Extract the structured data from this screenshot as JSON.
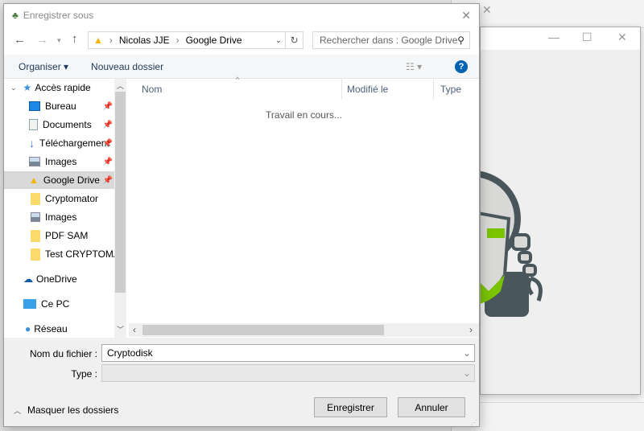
{
  "dialog": {
    "title": "Enregistrer sous",
    "close": "✕"
  },
  "address": {
    "segments": [
      "Nicolas JJE",
      "Google Drive"
    ],
    "separator": "›"
  },
  "search": {
    "placeholder": "Rechercher dans : Google Drive"
  },
  "toolbar": {
    "organize": "Organiser ▾",
    "new_folder": "Nouveau dossier",
    "help": "?"
  },
  "nav": {
    "items": [
      {
        "label": "Accès rapide",
        "icon": "star-icon",
        "pinned": false
      },
      {
        "label": "Bureau",
        "icon": "desktop-icon",
        "pinned": true
      },
      {
        "label": "Documents",
        "icon": "documents-icon",
        "pinned": true
      },
      {
        "label": "Téléchargements",
        "icon": "download-icon",
        "pinned": true
      },
      {
        "label": "Images",
        "icon": "images-icon",
        "pinned": true
      },
      {
        "label": "Google Drive",
        "icon": "google-drive-icon",
        "pinned": true,
        "selected": true
      },
      {
        "label": "Cryptomator",
        "icon": "folder-icon"
      },
      {
        "label": "Images",
        "icon": "images-icon"
      },
      {
        "label": "PDF SAM",
        "icon": "folder-icon"
      },
      {
        "label": "Test CRYPTOMATOR",
        "icon": "folder-icon"
      },
      {
        "label": "OneDrive",
        "icon": "onedrive-icon"
      },
      {
        "label": "Ce PC",
        "icon": "pc-icon"
      },
      {
        "label": "Réseau",
        "icon": "network-icon"
      }
    ]
  },
  "columns": [
    "Nom",
    "Modifié le",
    "Type"
  ],
  "status": "Travail en cours...",
  "form": {
    "filename_label": "Nom du fichier :",
    "filename_value": "Cryptodisk",
    "type_label": "Type :",
    "type_value": ""
  },
  "footer": {
    "hide_folders": "Masquer les dossiers",
    "save": "Enregistrer",
    "cancel": "Annuler"
  },
  "colors": {
    "accent": "#0063b1",
    "brand_green": "#79c300",
    "robot_dark": "#49575c"
  }
}
